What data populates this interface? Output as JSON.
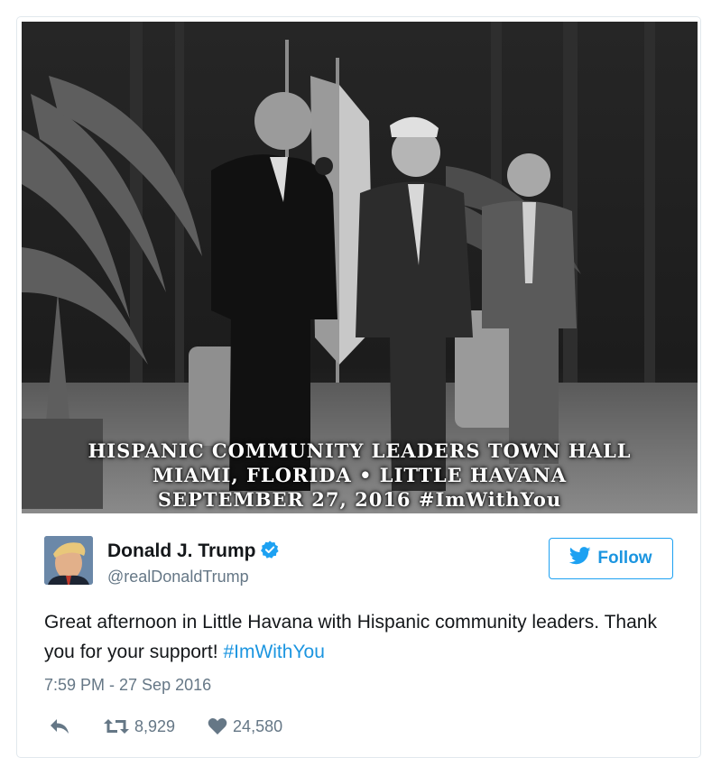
{
  "photo": {
    "caption_line1": "HISPANIC COMMUNITY LEADERS TOWN HALL",
    "caption_line2": "MIAMI, FLORIDA • LITTLE HAVANA",
    "caption_line3": "SEPTEMBER 27, 2016 #ImWithYou"
  },
  "user": {
    "display_name": "Donald J. Trump",
    "handle": "@realDonaldTrump",
    "verified": true
  },
  "follow_label": "Follow",
  "tweet": {
    "text": "Great afternoon in Little Havana with Hispanic community leaders. Thank you for your support! ",
    "hashtag": "#ImWithYou"
  },
  "timestamp": "7:59 PM - 27 Sep 2016",
  "stats": {
    "retweets": "8,929",
    "likes": "24,580"
  },
  "colors": {
    "accent": "#1da1f2",
    "link": "#1b95e0",
    "muted": "#657786"
  },
  "icons": {
    "reply": "reply-icon",
    "retweet": "retweet-icon",
    "like": "heart-icon",
    "verified": "verified-badge-icon",
    "bird": "twitter-bird-icon"
  }
}
